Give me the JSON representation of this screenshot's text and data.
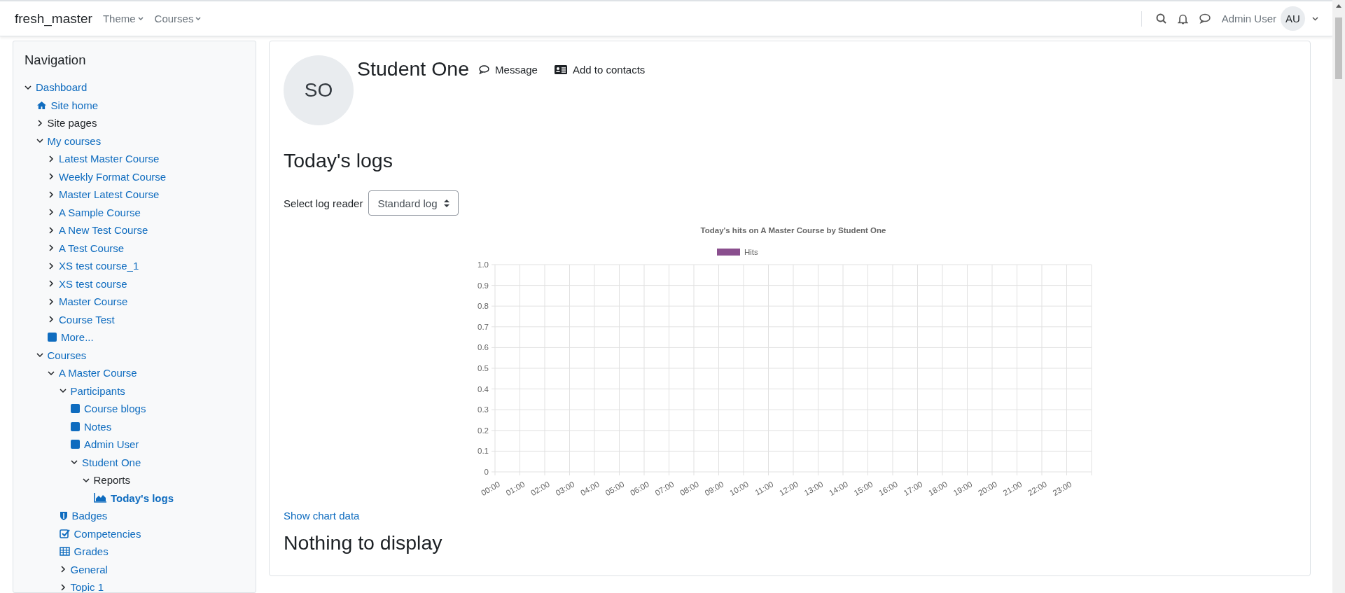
{
  "navbar": {
    "brand": "fresh_master",
    "menus": [
      {
        "label": "Theme"
      },
      {
        "label": "Courses"
      }
    ],
    "user_name": "Admin User",
    "user_initials": "AU"
  },
  "navigation": {
    "title": "Navigation",
    "items": [
      {
        "label": "Dashboard",
        "kind": "branch",
        "expanded": true,
        "link": true,
        "selected": false,
        "children": [
          {
            "label": "Site home",
            "kind": "home",
            "link": true,
            "selected": false
          },
          {
            "label": "Site pages",
            "kind": "branch",
            "expanded": false,
            "link": false,
            "selected": false
          },
          {
            "label": "My courses",
            "kind": "branch",
            "expanded": true,
            "link": true,
            "selected": false,
            "children": [
              {
                "label": "Latest Master Course",
                "kind": "branch",
                "expanded": false,
                "link": true,
                "selected": false
              },
              {
                "label": "Weekly Format Course",
                "kind": "branch",
                "expanded": false,
                "link": true,
                "selected": false
              },
              {
                "label": "Master Latest Course",
                "kind": "branch",
                "expanded": false,
                "link": true,
                "selected": false
              },
              {
                "label": "A Sample Course",
                "kind": "branch",
                "expanded": false,
                "link": true,
                "selected": false
              },
              {
                "label": "A New Test Course",
                "kind": "branch",
                "expanded": false,
                "link": true,
                "selected": false
              },
              {
                "label": "A Test Course",
                "kind": "branch",
                "expanded": false,
                "link": true,
                "selected": false
              },
              {
                "label": "XS test course_1",
                "kind": "branch",
                "expanded": false,
                "link": true,
                "selected": false
              },
              {
                "label": "XS test course",
                "kind": "branch",
                "expanded": false,
                "link": true,
                "selected": false
              },
              {
                "label": "Master Course",
                "kind": "branch",
                "expanded": false,
                "link": true,
                "selected": false
              },
              {
                "label": "Course Test",
                "kind": "branch",
                "expanded": false,
                "link": true,
                "selected": false
              },
              {
                "label": "More...",
                "kind": "square",
                "link": true,
                "selected": false
              }
            ]
          },
          {
            "label": "Courses",
            "kind": "branch",
            "expanded": true,
            "link": true,
            "selected": false,
            "children": [
              {
                "label": "A Master Course",
                "kind": "branch",
                "expanded": true,
                "link": true,
                "selected": false,
                "children": [
                  {
                    "label": "Participants",
                    "kind": "branch",
                    "expanded": true,
                    "link": true,
                    "selected": false,
                    "children": [
                      {
                        "label": "Course blogs",
                        "kind": "square",
                        "link": true,
                        "selected": false
                      },
                      {
                        "label": "Notes",
                        "kind": "square",
                        "link": true,
                        "selected": false
                      },
                      {
                        "label": "Admin User",
                        "kind": "square",
                        "link": true,
                        "selected": false
                      },
                      {
                        "label": "Student One",
                        "kind": "branch",
                        "expanded": true,
                        "link": true,
                        "selected": false,
                        "children": [
                          {
                            "label": "Reports",
                            "kind": "branch",
                            "expanded": true,
                            "link": false,
                            "selected": false,
                            "children": [
                              {
                                "label": "Today's logs",
                                "kind": "chart",
                                "link": true,
                                "selected": true
                              }
                            ]
                          }
                        ]
                      }
                    ]
                  },
                  {
                    "label": "Badges",
                    "kind": "shield",
                    "link": true,
                    "selected": false
                  },
                  {
                    "label": "Competencies",
                    "kind": "check",
                    "link": true,
                    "selected": false
                  },
                  {
                    "label": "Grades",
                    "kind": "table",
                    "link": true,
                    "selected": false
                  },
                  {
                    "label": "General",
                    "kind": "branch",
                    "expanded": false,
                    "link": true,
                    "selected": false
                  },
                  {
                    "label": "Topic 1",
                    "kind": "branch",
                    "expanded": false,
                    "link": true,
                    "selected": false
                  }
                ]
              }
            ]
          }
        ]
      }
    ]
  },
  "profile": {
    "initials": "SO",
    "name": "Student One",
    "actions": [
      {
        "label": "Message",
        "kind": "message"
      },
      {
        "label": "Add to contacts",
        "kind": "contact"
      }
    ]
  },
  "heading": "Today's logs",
  "log_reader": {
    "label": "Select log reader",
    "value": "Standard log"
  },
  "chart_data": {
    "type": "bar",
    "title": "Today's hits on A Master Course by Student One",
    "categories": [
      "00:00",
      "01:00",
      "02:00",
      "03:00",
      "04:00",
      "05:00",
      "06:00",
      "07:00",
      "08:00",
      "09:00",
      "10:00",
      "11:00",
      "12:00",
      "13:00",
      "14:00",
      "15:00",
      "16:00",
      "17:00",
      "18:00",
      "19:00",
      "20:00",
      "21:00",
      "22:00",
      "23:00"
    ],
    "series": [
      {
        "name": "Hits",
        "color": "#8a4f8e",
        "values": [
          0,
          0,
          0,
          0,
          0,
          0,
          0,
          0,
          0,
          0,
          0,
          0,
          0,
          0,
          0,
          0,
          0,
          0,
          0,
          0,
          0,
          0,
          0,
          0
        ]
      }
    ],
    "ylim": [
      0,
      1
    ],
    "grid": true,
    "yticks": [
      {
        "value": 0,
        "label": "0"
      },
      0.1,
      0.2,
      0.3,
      0.4,
      0.5,
      0.6,
      0.7,
      0.8,
      0.9,
      {
        "value": 1,
        "label": "1.0"
      }
    ]
  },
  "show_chart_data": "Show chart data",
  "empty_message": "Nothing to display"
}
